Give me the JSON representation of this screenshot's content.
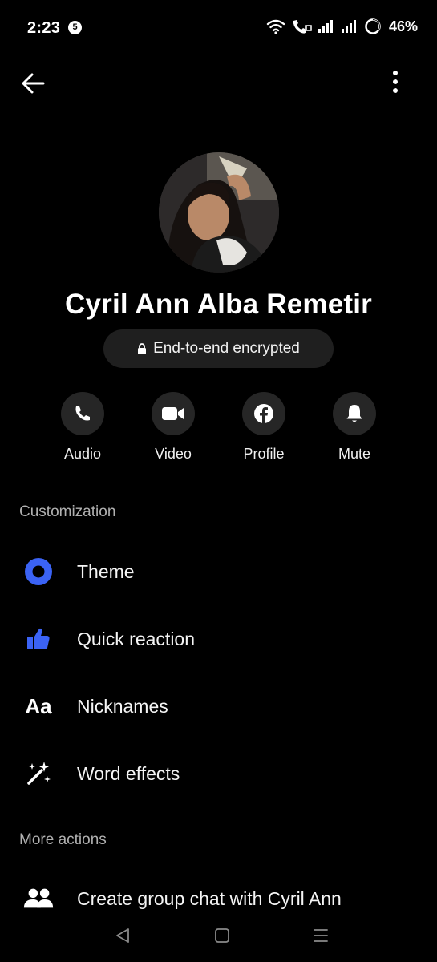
{
  "status_bar": {
    "time": "2:23",
    "notification_count": "5",
    "battery": "46%"
  },
  "contact": {
    "name": "Cyril Ann Alba Remetir",
    "encryption_label": "End-to-end encrypted"
  },
  "actions": [
    {
      "label": "Audio",
      "icon": "phone-icon"
    },
    {
      "label": "Video",
      "icon": "video-camera-icon"
    },
    {
      "label": "Profile",
      "icon": "facebook-icon"
    },
    {
      "label": "Mute",
      "icon": "bell-icon"
    }
  ],
  "customization": {
    "title": "Customization",
    "items": [
      {
        "label": "Theme",
        "icon": "theme-icon"
      },
      {
        "label": "Quick reaction",
        "icon": "thumbs-up-icon"
      },
      {
        "label": "Nicknames",
        "icon": "nicknames-icon",
        "icon_text": "Aa"
      },
      {
        "label": "Word effects",
        "icon": "magic-wand-icon"
      }
    ]
  },
  "more_actions": {
    "title": "More actions",
    "items": [
      {
        "label": "Create group chat with Cyril Ann",
        "icon": "group-icon"
      }
    ]
  },
  "colors": {
    "accent": "#3b63f5",
    "background": "#000000",
    "button_bg": "#262626"
  }
}
